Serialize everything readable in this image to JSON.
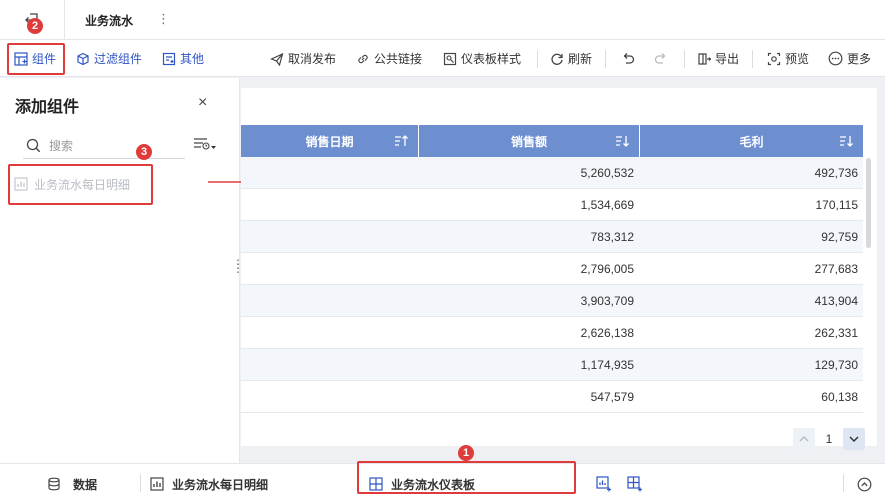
{
  "header": {
    "title": "业务流水",
    "more_glyph": "⋮"
  },
  "toolbar": {
    "component_label": "组件",
    "filter_component_label": "过滤组件",
    "other_label": "其他",
    "unpublish_label": "取消发布",
    "public_link_label": "公共链接",
    "dashboard_style_label": "仪表板样式",
    "refresh_label": "刷新",
    "export_label": "导出",
    "preview_label": "预览",
    "more_label": "更多"
  },
  "panel": {
    "title": "添加组件",
    "close_glyph": "×",
    "search_placeholder": "搜索",
    "item_label": "业务流水每日明细"
  },
  "table": {
    "columns": [
      "销售日期",
      "销售额",
      "毛利"
    ],
    "rows": [
      {
        "sales": "5,260,532",
        "profit": "492,736"
      },
      {
        "sales": "1,534,669",
        "profit": "170,115"
      },
      {
        "sales": "783,312",
        "profit": "92,759"
      },
      {
        "sales": "2,796,005",
        "profit": "277,683"
      },
      {
        "sales": "3,903,709",
        "profit": "413,904"
      },
      {
        "sales": "2,626,138",
        "profit": "262,331"
      },
      {
        "sales": "1,174,935",
        "profit": "129,730"
      },
      {
        "sales": "547,579",
        "profit": "60,138"
      }
    ]
  },
  "pager": {
    "current_page": "1"
  },
  "bottom": {
    "data_label": "数据",
    "sheet_label": "业务流水每日明细",
    "dashboard_label": "业务流水仪表板"
  },
  "annotations": {
    "badge_1": "1",
    "badge_2": "2",
    "badge_3": "3"
  },
  "colors": {
    "accent": "#2f55c5",
    "table_header": "#6e8fcf",
    "annotation_red": "#e03b3b"
  }
}
